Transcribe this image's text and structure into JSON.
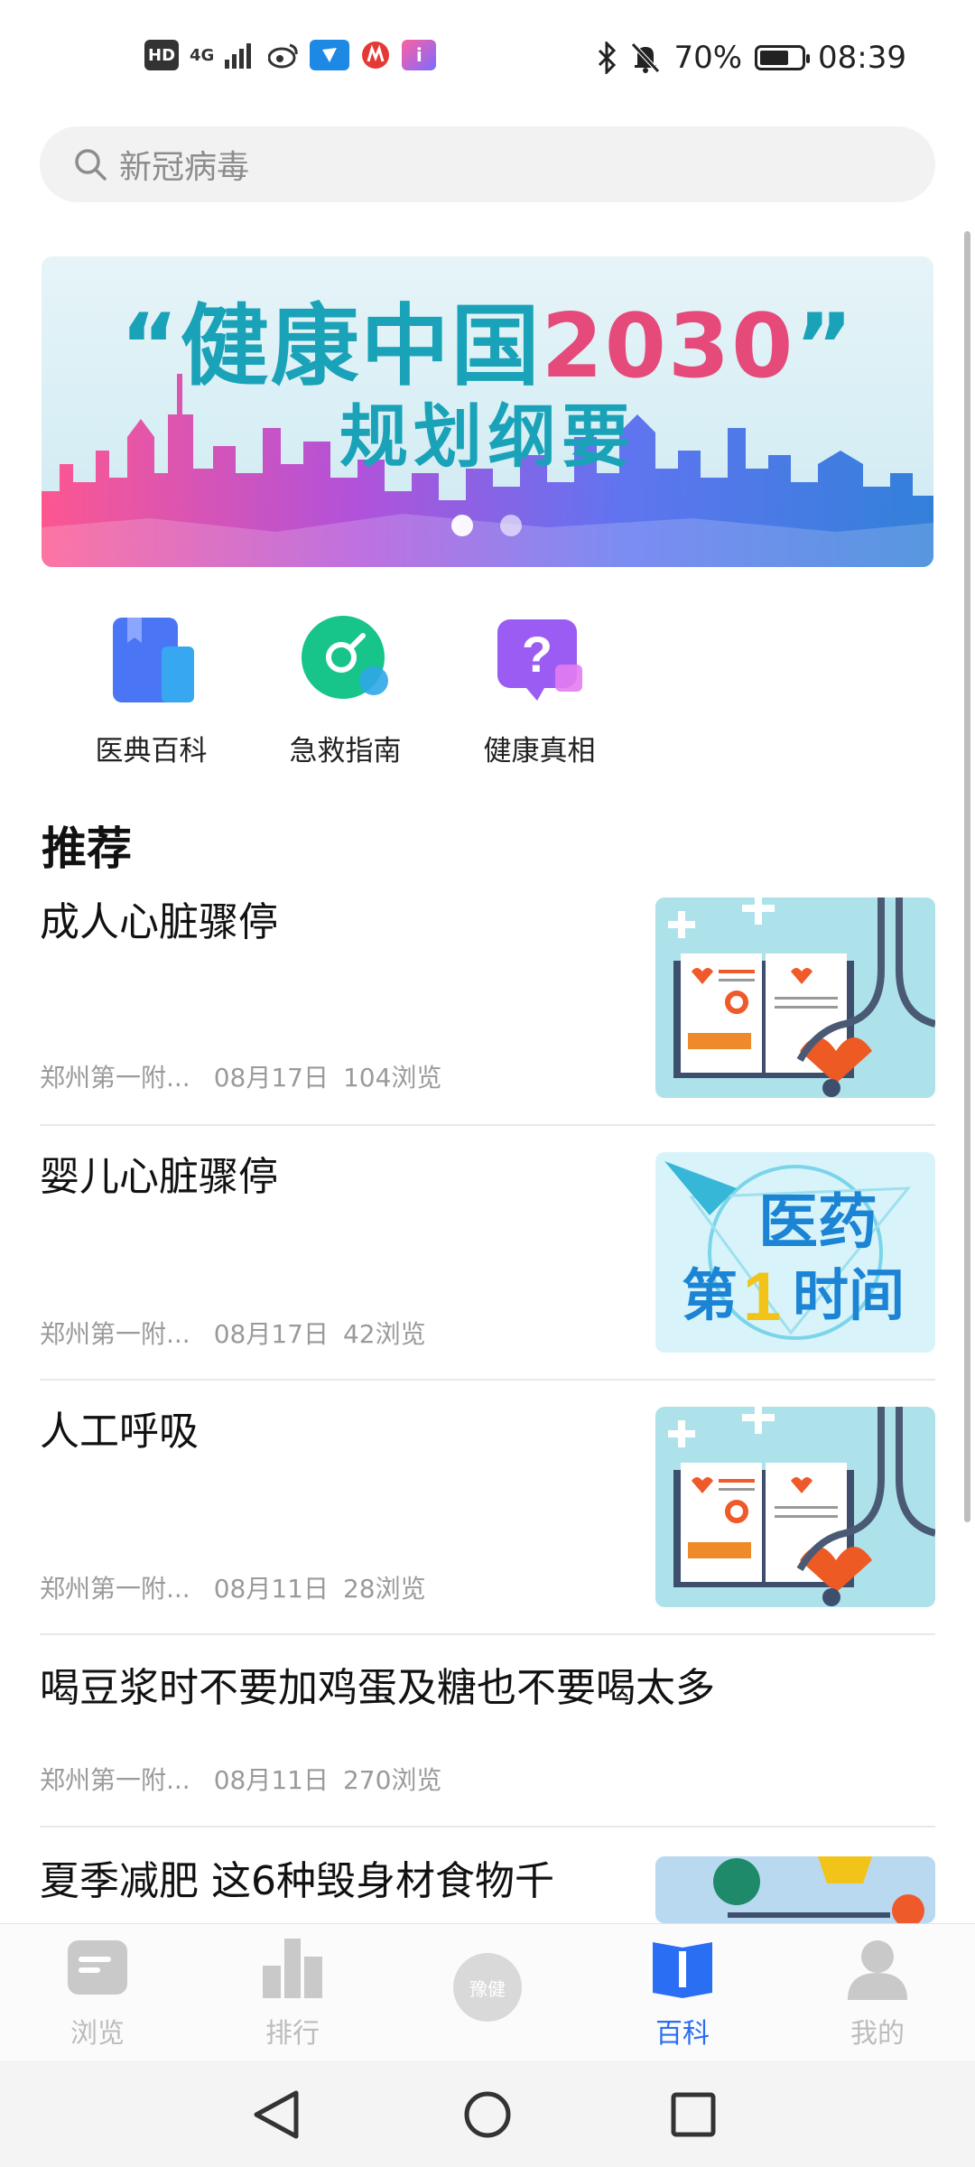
{
  "status_bar": {
    "left_icons": [
      "HD",
      "4G",
      "signal-icon",
      "weibo-icon",
      "app-icon-blue",
      "metro-icon",
      "app-icon-i"
    ],
    "battery": "70%",
    "battery_level": 0.7,
    "time": "08:39"
  },
  "search": {
    "placeholder": "新冠病毒"
  },
  "banner": {
    "line1_prefix": "“健康中国",
    "line1_year": "2030",
    "line1_suffix": "”",
    "line2": "规划纲要",
    "page_count": 2,
    "active_index": 0
  },
  "quick_actions": [
    {
      "label": "医典百科",
      "icon": "book-icon",
      "color": "#4a76f5"
    },
    {
      "label": "急救指南",
      "icon": "first-aid-icon",
      "color": "#17c48a"
    },
    {
      "label": "健康真相",
      "icon": "question-icon",
      "color": "#9a5cf2"
    }
  ],
  "section": {
    "title": "推荐"
  },
  "articles": [
    {
      "title": "成人心脏骤停",
      "source": "郑州第一附...",
      "date": "08月17日",
      "views": "104浏览",
      "thumb": "medical-book-thumb"
    },
    {
      "title": "婴儿心脏骤停",
      "source": "郑州第一附...",
      "date": "08月17日",
      "views": "42浏览",
      "thumb": "yiyao-thumb",
      "thumb_text": [
        "医药",
        "第",
        "1",
        "时间"
      ]
    },
    {
      "title": "人工呼吸",
      "source": "郑州第一附...",
      "date": "08月11日",
      "views": "28浏览",
      "thumb": "medical-book-thumb"
    },
    {
      "title": "喝豆浆时不要加鸡蛋及糖也不要喝太多",
      "source": "郑州第一附...",
      "date": "08月11日",
      "views": "270浏览"
    },
    {
      "title": "夏季减肥 这6种毁身材食物千",
      "thumb": "food-thumb"
    }
  ],
  "bottom_nav": [
    {
      "label": "浏览",
      "icon": "browse-icon"
    },
    {
      "label": "排行",
      "icon": "ranking-icon"
    },
    {
      "label": "豫健",
      "icon": "center-logo-icon"
    },
    {
      "label": "百科",
      "icon": "encyclopedia-icon",
      "active": true
    },
    {
      "label": "我的",
      "icon": "profile-icon"
    }
  ],
  "colors": {
    "accent": "#2a6ef4",
    "banner_text": "#1aa3b8",
    "banner_year": "#e64a7a"
  }
}
